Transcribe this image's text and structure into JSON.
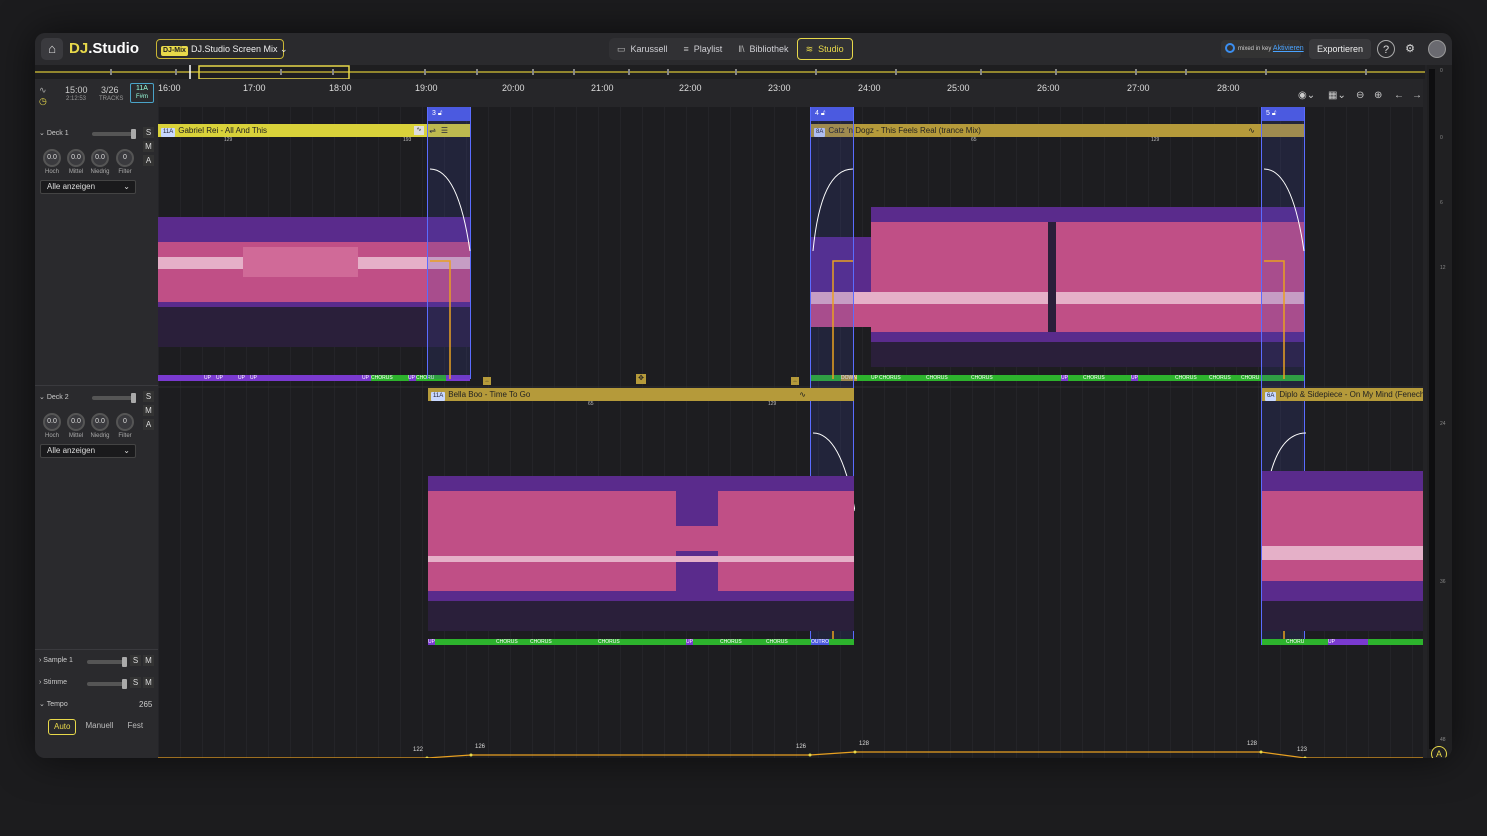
{
  "app": {
    "logo_main": "DJ",
    "logo_rest": ".Studio",
    "mix_tag": "DJ-Mix",
    "mix_name": "DJ.Studio Screen Mix"
  },
  "nav": [
    {
      "label": "Karussell",
      "icon": "carousel-icon"
    },
    {
      "label": "Playlist",
      "icon": "playlist-icon"
    },
    {
      "label": "Bibliothek",
      "icon": "library-icon"
    },
    {
      "label": "Studio",
      "icon": "studio-icon"
    }
  ],
  "account": {
    "brand": "mixed in key",
    "link": "Aktivieren"
  },
  "export_label": "Exportieren",
  "status": {
    "time": "15:00",
    "subtime": "2:12:53",
    "tracks": "3/26",
    "tracks_label": "TRACKS",
    "key": "11A",
    "key_sub": "F#m"
  },
  "ruler": [
    "16:00",
    "17:00",
    "18:00",
    "19:00",
    "20:00",
    "21:00",
    "22:00",
    "23:00",
    "24:00",
    "25:00",
    "26:00",
    "27:00",
    "28:00"
  ],
  "decks": [
    {
      "name": "Deck 1",
      "knobs": [
        {
          "v": "0.0",
          "l": "Hoch"
        },
        {
          "v": "0.0",
          "l": "Mittel"
        },
        {
          "v": "0.0",
          "l": "Niedrig"
        },
        {
          "v": "0",
          "l": "Filter"
        }
      ],
      "select": "Alle anzeigen"
    },
    {
      "name": "Deck 2",
      "knobs": [
        {
          "v": "0.0",
          "l": "Hoch"
        },
        {
          "v": "0.0",
          "l": "Mittel"
        },
        {
          "v": "0.0",
          "l": "Niedrig"
        },
        {
          "v": "0",
          "l": "Filter"
        }
      ],
      "select": "Alle anzeigen"
    }
  ],
  "smb": {
    "s": "S",
    "m": "M",
    "a": "A"
  },
  "extra_tracks": [
    "Sample 1",
    "Stimme"
  ],
  "tempo": {
    "label": "Tempo",
    "value": "265",
    "modes": [
      "Auto",
      "Manuell",
      "Fest"
    ],
    "points": [
      "122",
      "126",
      "126",
      "128",
      "128",
      "123"
    ],
    "bottom": "95"
  },
  "clips": {
    "c1": {
      "key": "11A",
      "title": "Gabriel Rei - All And This",
      "m1": "129",
      "m2": "193"
    },
    "c2": {
      "key": "8A",
      "title": "Catz 'n Dogz - This Feels Real (trance Mix)",
      "m1": "65",
      "m2": "129"
    },
    "c3": {
      "key": "11A",
      "title": "Bella Boo - Time To Go",
      "m1": "65",
      "m2": "129"
    },
    "c4": {
      "key": "6A",
      "title": "Diplo & Sidepiece - On My Mind (Fenech",
      "m1": "0"
    }
  },
  "transitions": [
    "3",
    "4",
    "5"
  ],
  "sections": {
    "up": "UP",
    "chorus": "CHORUS",
    "down": "DOWN",
    "outro": "OUTRO",
    "chorus_short": "CHORU"
  },
  "vu_scale": [
    "0",
    "0",
    "6",
    "12",
    "24",
    "36",
    "48"
  ],
  "colors": {
    "accent": "#e8d94a",
    "transition": "#4b5ae0",
    "wave_pink": "#d05a8c",
    "wave_purple": "#6b2fa8",
    "chorus": "#2db32d"
  }
}
